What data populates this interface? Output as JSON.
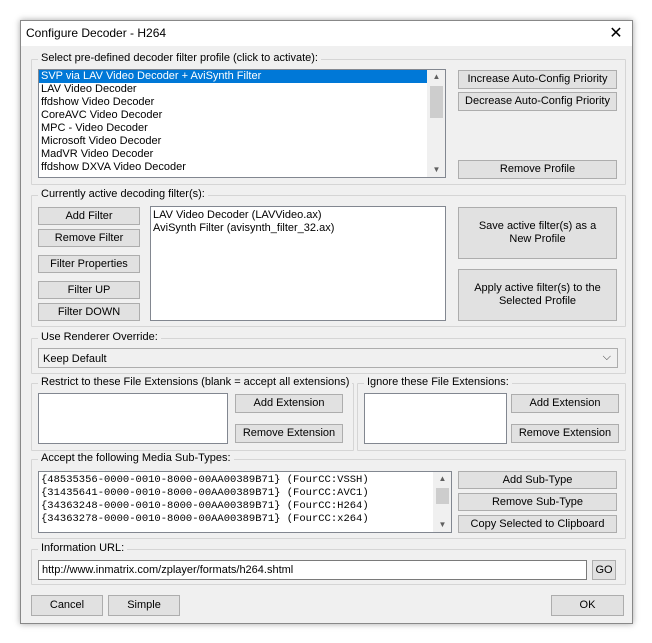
{
  "window": {
    "title": "Configure Decoder - H264",
    "close_glyph": "✕"
  },
  "profiles": {
    "label": "Select pre-defined decoder filter profile (click to activate):",
    "items": [
      "SVP via LAV Video Decoder + AviSynth Filter",
      "LAV Video Decoder",
      "ffdshow Video Decoder",
      "CoreAVC Video Decoder",
      "MPC - Video Decoder",
      "Microsoft Video Decoder",
      "MadVR Video Decoder",
      "ffdshow DXVA Video Decoder"
    ],
    "selected_index": 0,
    "increase_label": "Increase Auto-Config Priority",
    "decrease_label": "Decrease Auto-Config Priority",
    "remove_label": "Remove Profile"
  },
  "active_filters": {
    "label": "Currently active decoding filter(s):",
    "items": [
      "LAV Video Decoder (LAVVideo.ax)",
      "AviSynth Filter (avisynth_filter_32.ax)"
    ],
    "add_label": "Add Filter",
    "remove_label": "Remove Filter",
    "properties_label": "Filter Properties",
    "up_label": "Filter UP",
    "down_label": "Filter DOWN",
    "save_label": "Save active filter(s) as a New Profile",
    "apply_label": "Apply active filter(s) to the Selected Profile"
  },
  "renderer": {
    "label": "Use Renderer Override:",
    "value": "Keep Default"
  },
  "restrict_ext": {
    "label": "Restrict to these File Extensions (blank = accept all extensions)",
    "add_label": "Add Extension",
    "remove_label": "Remove Extension"
  },
  "ignore_ext": {
    "label": "Ignore these File Extensions:",
    "add_label": "Add Extension",
    "remove_label": "Remove Extension"
  },
  "subtypes": {
    "label": "Accept the following Media Sub-Types:",
    "items": [
      "{48535356-0000-0010-8000-00AA00389B71} (FourCC:VSSH)",
      "{31435641-0000-0010-8000-00AA00389B71} (FourCC:AVC1)",
      "{34363248-0000-0010-8000-00AA00389B71} (FourCC:H264)",
      "{34363278-0000-0010-8000-00AA00389B71} (FourCC:x264)"
    ],
    "add_label": "Add Sub-Type",
    "remove_label": "Remove Sub-Type",
    "copy_label": "Copy Selected to Clipboard"
  },
  "info_url": {
    "label": "Information URL:",
    "value": "http://www.inmatrix.com/zplayer/formats/h264.shtml",
    "go_label": "GO"
  },
  "footer": {
    "cancel_label": "Cancel",
    "simple_label": "Simple",
    "ok_label": "OK"
  },
  "colors": {
    "selection": "#0078d7",
    "button_face": "#e1e1e1",
    "dialog_bg": "#f0f0f0"
  }
}
